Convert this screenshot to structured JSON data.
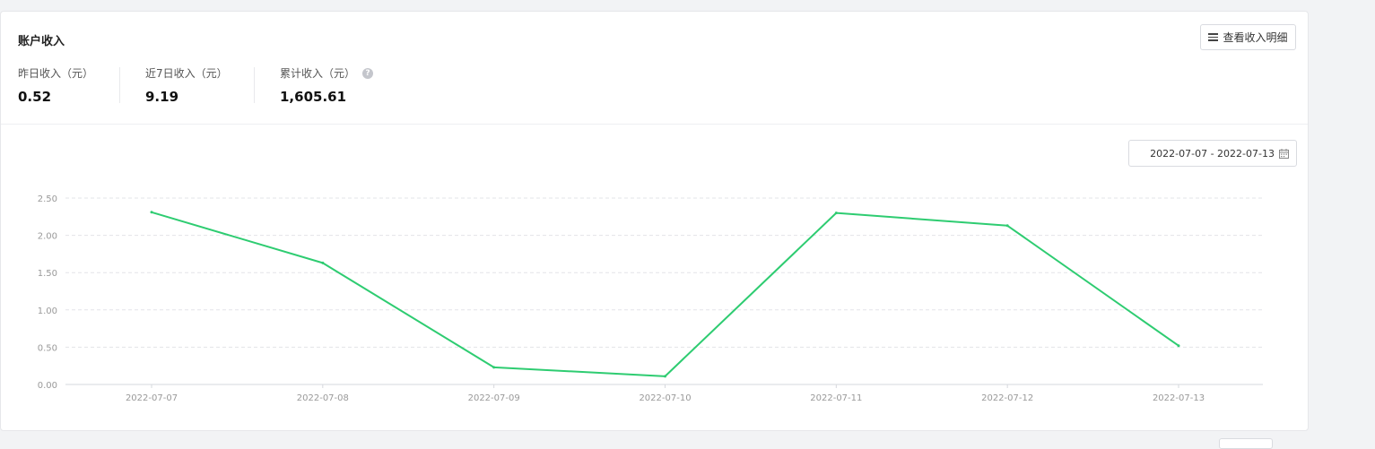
{
  "card": {
    "title": "账户收入",
    "detail_button": "查看收入明细"
  },
  "stats": [
    {
      "label": "昨日收入（元）",
      "value": "0.52"
    },
    {
      "label": "近7日收入（元）",
      "value": "9.19"
    },
    {
      "label": "累计收入（元）",
      "value": "1,605.61",
      "help_icon": "question-circle-icon"
    }
  ],
  "date_range": {
    "value": "2022-07-07 - 2022-07-13",
    "icon": "calendar-icon"
  },
  "icons": {
    "detail": "menu-icon",
    "help": "question-circle-icon",
    "date": "calendar-icon"
  },
  "chart_data": {
    "type": "line",
    "title": "",
    "xlabel": "",
    "ylabel": "",
    "categories": [
      "2022-07-07",
      "2022-07-08",
      "2022-07-09",
      "2022-07-10",
      "2022-07-11",
      "2022-07-12",
      "2022-07-13"
    ],
    "series": [
      {
        "values": [
          2.31,
          1.63,
          0.23,
          0.11,
          2.3,
          2.13,
          0.52
        ]
      }
    ],
    "y_ticks": [
      "0.00",
      "0.50",
      "1.00",
      "1.50",
      "2.00",
      "2.50"
    ],
    "ylim": [
      0,
      2.5
    ],
    "grid": "horizontal-dashed",
    "colors": {
      "line": "#2ecc71",
      "grid": "#e3e4e8",
      "axis_text": "#999999"
    }
  }
}
